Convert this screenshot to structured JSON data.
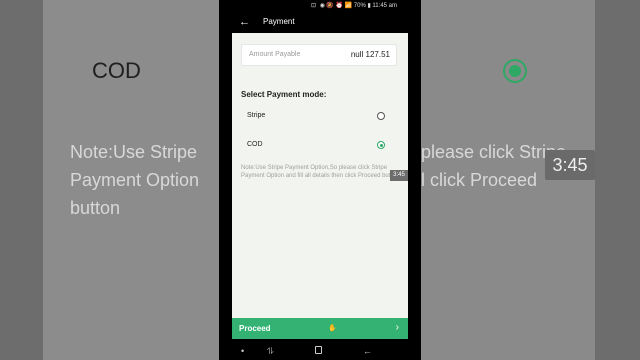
{
  "background": {
    "cod_label": "COD",
    "note_left_lines": [
      "Note:Use Stripe",
      "Payment Option",
      "button"
    ],
    "note_right_lines": [
      "please click Stripe",
      "l click Proceed"
    ],
    "time_label": "3:45"
  },
  "status_bar": {
    "left_icons": "⊡ ◉ ◔ ◆",
    "right_text": "🔕 ⏰ 📶 70% ▮ 11:45 am"
  },
  "header": {
    "title": "Payment",
    "back_icon": "arrow-left"
  },
  "amount": {
    "label": "Amount Payable",
    "value": "null 127.51"
  },
  "payment_modes": {
    "title": "Select Payment mode:",
    "options": [
      {
        "label": "Stripe",
        "selected": false
      },
      {
        "label": "COD",
        "selected": true
      }
    ]
  },
  "note": "Note:Use Stripe Payment Option,So please click Stripe Payment Option and fill all details then click Proceed button",
  "proceed": {
    "label": "Proceed",
    "arrow": "›"
  },
  "video_time": "3:45",
  "nav_bar": {
    "dot": "•",
    "recent": "⥮",
    "back": "←"
  },
  "colors": {
    "accent": "#33b274",
    "content_bg": "#f2f4ef"
  }
}
